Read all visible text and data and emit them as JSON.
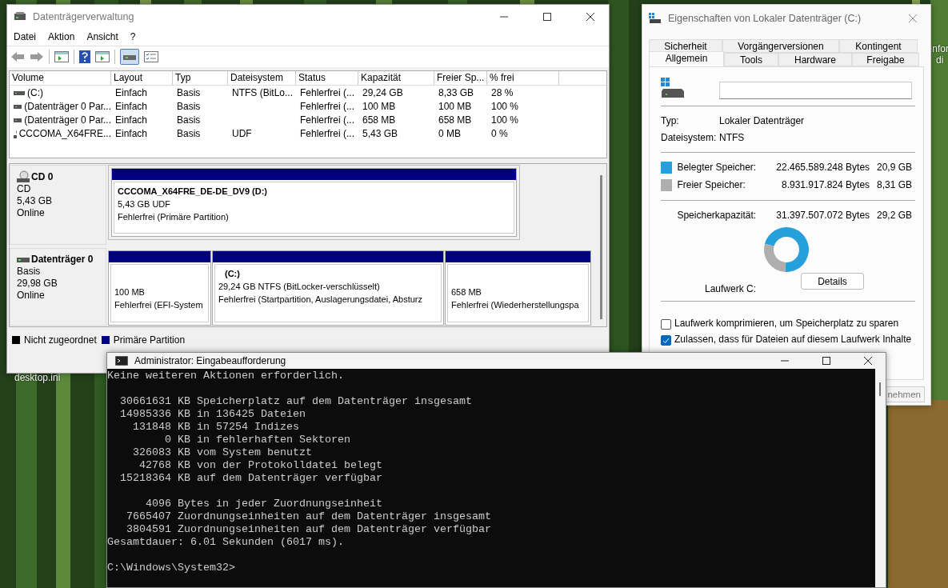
{
  "desktop": {
    "icon_labels": [
      "desktop.ini"
    ],
    "edge_label_lines": [
      "Infor",
      "di"
    ]
  },
  "disk_management": {
    "title": "Datenträgerverwaltung",
    "menu": [
      "Datei",
      "Aktion",
      "Ansicht",
      "?"
    ],
    "volumes": {
      "columns": [
        "Volume",
        "Layout",
        "Typ",
        "Dateisystem",
        "Status",
        "Kapazität",
        "Freier Sp...",
        "% frei"
      ],
      "rows": [
        {
          "kind": "drive",
          "cells": [
            " (C:)",
            "Einfach",
            "Basis",
            "NTFS (BitLo...",
            "Fehlerfrei (...",
            "29,24 GB",
            "8,33 GB",
            "28 %"
          ]
        },
        {
          "kind": "drive",
          "cells": [
            "(Datenträger 0 Par...",
            "Einfach",
            "Basis",
            "",
            "Fehlerfrei (...",
            "100 MB",
            "100 MB",
            "100 %"
          ]
        },
        {
          "kind": "drive",
          "cells": [
            "(Datenträger 0 Par...",
            "Einfach",
            "Basis",
            "",
            "Fehlerfrei (...",
            "658 MB",
            "658 MB",
            "100 %"
          ]
        },
        {
          "kind": "cd",
          "cells": [
            "CCCOMA_X64FRE...",
            "Einfach",
            "Basis",
            "UDF",
            "Fehlerfrei (...",
            "5,43 GB",
            "0 MB",
            "0 %"
          ]
        }
      ]
    },
    "disks": [
      {
        "kind": "cd",
        "name": "CD 0",
        "type": "CD",
        "size": "5,43 GB",
        "status": "Online",
        "partitions": [
          {
            "name": "CCCOMA_X64FRE_DE-DE_DV9  (D:)",
            "size": "5,43 GB UDF",
            "status": "Fehlerfrei (Primäre Partition)"
          }
        ]
      },
      {
        "kind": "drive",
        "name": "Datenträger 0",
        "type": "Basis",
        "size": "29,98 GB",
        "status": "Online",
        "partitions": [
          {
            "size": "100 MB",
            "status": "Fehlerfrei (EFI-System"
          },
          {
            "name": "(C:)",
            "size": "29,24 GB NTFS (BitLocker-verschlüsselt)",
            "status": "Fehlerfrei (Startpartition, Auslagerungsdatei, Absturz"
          },
          {
            "size": "658 MB",
            "status": "Fehlerfrei (Wiederherstellungspa"
          }
        ]
      }
    ],
    "legend": [
      {
        "label": "Nicht zugeordnet",
        "color": "#000000"
      },
      {
        "label": "Primäre Partition",
        "color": "#000080"
      }
    ]
  },
  "properties": {
    "title": "Eigenschaften von Lokaler Datenträger (C:)",
    "tab_rows": [
      [
        {
          "label": "Sicherheit",
          "selected": false
        },
        {
          "label": "Vorgängerversionen",
          "selected": false
        },
        {
          "label": "Kontingent",
          "selected": false
        }
      ],
      [
        {
          "label": "Allgemein",
          "selected": true
        },
        {
          "label": "Tools",
          "selected": false
        },
        {
          "label": "Hardware",
          "selected": false
        },
        {
          "label": "Freigabe",
          "selected": false
        }
      ]
    ],
    "info": [
      {
        "label": "Typ:",
        "value": "Lokaler Datenträger"
      },
      {
        "label": "Dateisystem:",
        "value": "NTFS"
      }
    ],
    "usage": [
      {
        "label": "Belegter Speicher:",
        "bytes": "22.465.589.248 Bytes",
        "size": "20,9 GB",
        "color": "#26a0da"
      },
      {
        "label": "Freier Speicher:",
        "bytes": "8.931.917.824 Bytes",
        "size": "8,31 GB",
        "color": "#aeaeae"
      }
    ],
    "capacity": {
      "label": "Speicherkapazität:",
      "bytes": "31.397.507.072 Bytes",
      "size": "29,2 GB"
    },
    "chart_data": {
      "type": "donut",
      "values": [
        71.6,
        28.4
      ]
    },
    "drive_label": "Laufwerk C:",
    "details_button": "Details",
    "checkboxes": [
      {
        "label": "Laufwerk komprimieren, um Speicherplatz zu sparen",
        "checked": false
      },
      {
        "label": "Zulassen, dass für Dateien auf diesem Laufwerk Inhalte",
        "checked": true
      }
    ],
    "apply_button": "nehmen"
  },
  "console": {
    "title": "Administrator: Eingabeaufforderung",
    "blocks": [
      [
        "Keine weiteren Aktionen erforderlich."
      ],
      [
        "  30661631 KB Speicherplatz auf dem Datenträger insgesamt",
        "  14985336 KB in 136425 Dateien",
        "    131848 KB in 57254 Indizes",
        "         0 KB in fehlerhaften Sektoren",
        "    326083 KB vom System benutzt",
        "     42768 KB von der Protokolldatei belegt",
        "  15218364 KB auf dem Datenträger verfügbar"
      ],
      [
        "      4096 Bytes in jeder Zuordnungseinheit",
        "   7665407 Zuordnungseinheiten auf dem Datenträger insgesamt",
        "   3804591 Zuordnungseinheiten auf dem Datenträger verfügbar",
        "Gesamtdauer: 6.01 Sekunden (6017 ms)."
      ],
      [
        "C:\\Windows\\System32>"
      ]
    ]
  }
}
